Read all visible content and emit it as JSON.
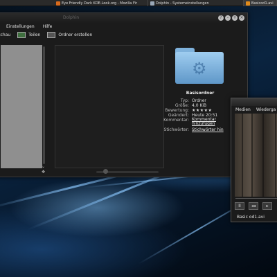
{
  "taskbar": {
    "tasks": [
      {
        "label": "Eye Friendly Dark KDE-Look.org - Mozilla Fir",
        "icon": "firefox-icon",
        "color": "#d96a1c"
      },
      {
        "label": "Dolphin - Systemeinstellungen",
        "icon": "settings-icon",
        "color": "#9aa8b8"
      },
      {
        "label": "Basicod1.avi",
        "icon": "media-player-icon",
        "color": "#e08a1a"
      }
    ]
  },
  "dolphin": {
    "title": "Dolphin",
    "menu": [
      "Einstellungen",
      "Hilfe"
    ],
    "toolbar": {
      "preview_label": "rschau",
      "share_label": "Teilen",
      "new_folder_label": "Ordner erstellen"
    },
    "info": {
      "title": "Basisordner",
      "rows": [
        {
          "key": "Typ:",
          "value": "Ordner"
        },
        {
          "key": "Größe:",
          "value": "4,0 KiB"
        },
        {
          "key": "Bewertung:",
          "value": "★★★★★"
        },
        {
          "key": "Geändert:",
          "value": "Heute 20:51"
        },
        {
          "key": "Kommentar:",
          "value": "Kommentar hinzufügen"
        },
        {
          "key": "Stichwörter:",
          "value": "Stichwörter hin"
        }
      ]
    }
  },
  "player": {
    "menu": [
      "Medien",
      "Wiederga"
    ],
    "file": "Basic od1.avi",
    "controls": {
      "pause": "II",
      "prev": "◂◂",
      "next": "▸"
    }
  }
}
